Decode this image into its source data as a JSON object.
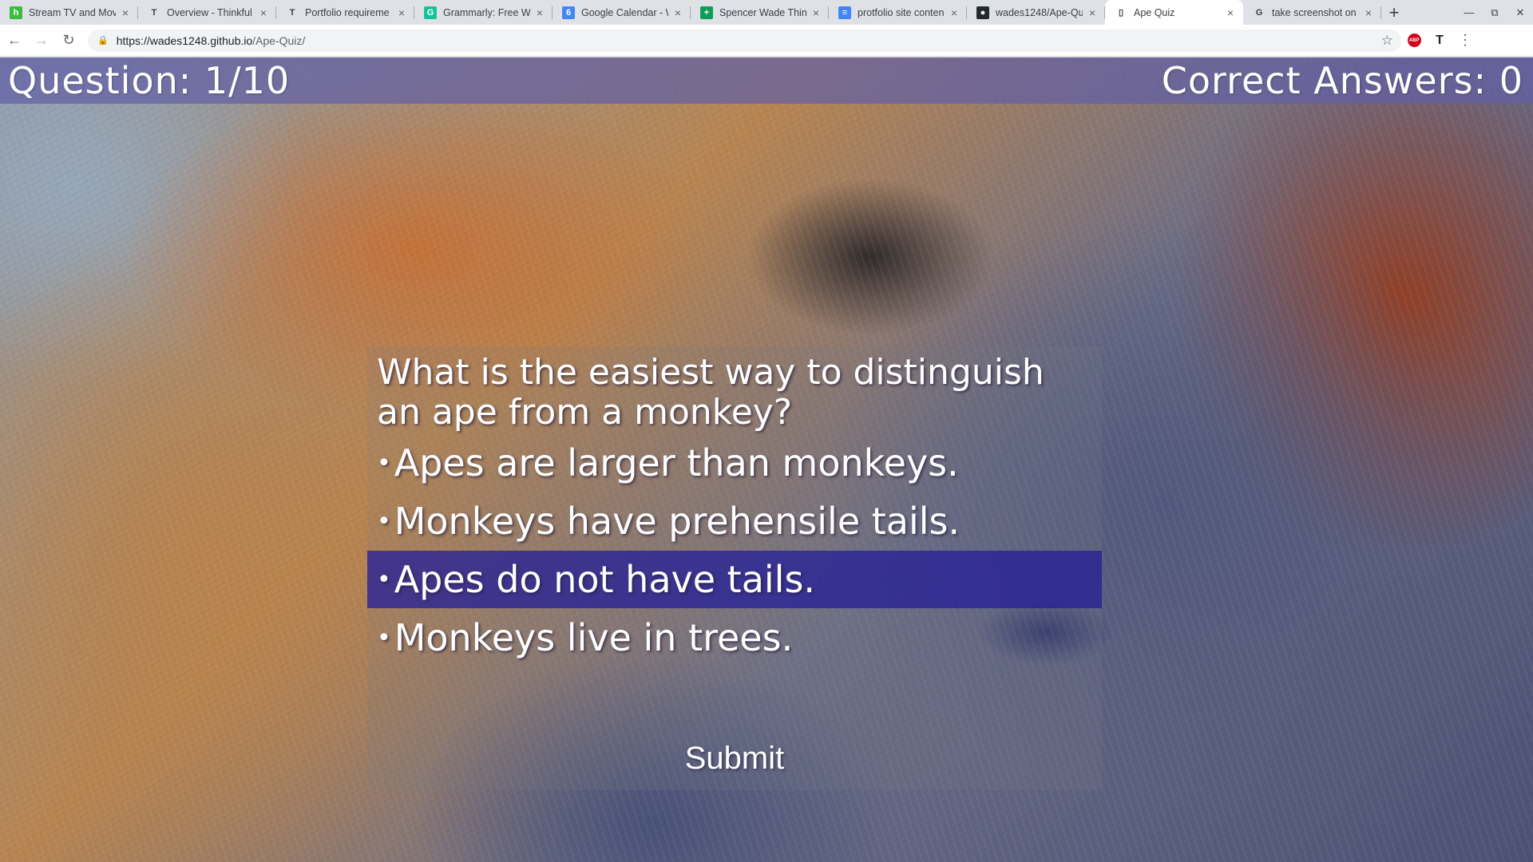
{
  "browser": {
    "tabs": [
      {
        "title": "Stream TV and Mov",
        "favicon": "hulu-icon",
        "color": "#3dbb3d",
        "glyph": "h"
      },
      {
        "title": "Overview - Thinkful",
        "favicon": "thinkful-icon",
        "color": "",
        "glyph": "T"
      },
      {
        "title": "Portfolio requireme",
        "favicon": "thinkful-icon",
        "color": "",
        "glyph": "T"
      },
      {
        "title": "Grammarly: Free Wr",
        "favicon": "grammarly-icon",
        "color": "#15c39a",
        "glyph": "G"
      },
      {
        "title": "Google Calendar - W",
        "favicon": "google-calendar-icon",
        "color": "#4285f4",
        "glyph": "6"
      },
      {
        "title": "Spencer Wade Think",
        "favicon": "google-sheets-icon",
        "color": "#0f9d58",
        "glyph": "+"
      },
      {
        "title": "protfolio site conten",
        "favicon": "google-docs-icon",
        "color": "#4285f4",
        "glyph": "≡"
      },
      {
        "title": "wades1248/Ape-Qu",
        "favicon": "github-icon",
        "color": "#24292e",
        "glyph": "●"
      },
      {
        "title": "Ape Quiz",
        "favicon": "page-icon",
        "color": "",
        "glyph": "▯",
        "active": true
      },
      {
        "title": "take screenshot on",
        "favicon": "google-icon",
        "color": "",
        "glyph": "G"
      }
    ],
    "url_host": "https://wades1248.github.io",
    "url_path": "/Ape-Quiz/"
  },
  "quiz": {
    "question_counter": "Question: 1/10",
    "score": "Correct Answers: 0",
    "question": "What is the easiest way to distinguish an ape from a monkey?",
    "bullet": "•",
    "answers": [
      "Apes are larger than monkeys.",
      "Monkeys have prehensile tails.",
      "Apes do not have tails.",
      "Monkeys live in trees."
    ],
    "selected_index": 2,
    "submit_label": "Submit"
  },
  "colors": {
    "topbar": "#6260a5",
    "selected_answer": "#262096"
  }
}
